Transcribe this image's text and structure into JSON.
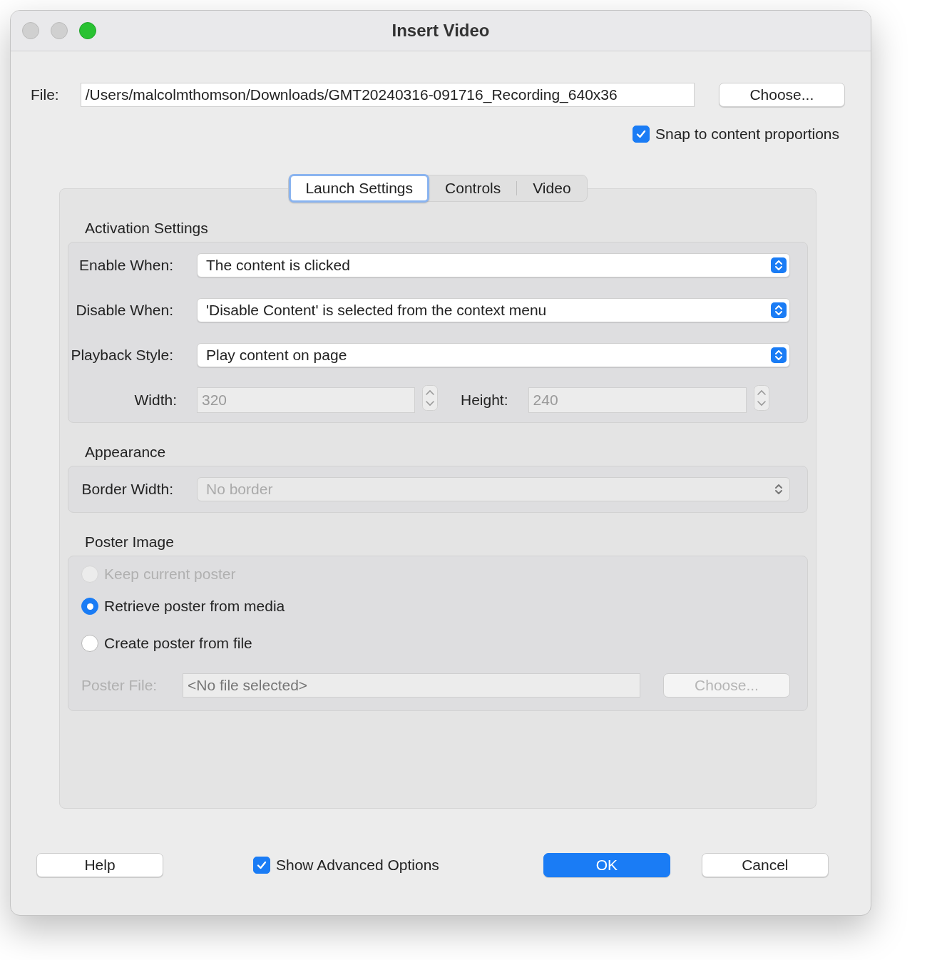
{
  "window": {
    "title": "Insert Video"
  },
  "file": {
    "label": "File:",
    "value": "/Users/malcolmthomson/Downloads/GMT20240316-091716_Recording_640x36",
    "button": "Choose..."
  },
  "snap": {
    "label": "Snap to content proportions",
    "checked": true
  },
  "tabs": [
    {
      "label": "Launch Settings",
      "selected": true
    },
    {
      "label": "Controls",
      "selected": false
    },
    {
      "label": "Video",
      "selected": false
    }
  ],
  "activation": {
    "title": "Activation Settings",
    "rows": [
      {
        "label": "Enable When:",
        "value": "The content is clicked"
      },
      {
        "label": "Disable When:",
        "value": "'Disable Content' is selected from the context menu"
      },
      {
        "label": "Playback Style:",
        "value": "Play content on page"
      }
    ],
    "width": {
      "label": "Width:",
      "value": "320",
      "disabled": true
    },
    "height": {
      "label": "Height:",
      "value": "240",
      "disabled": true
    }
  },
  "appearance": {
    "title": "Appearance",
    "border": {
      "label": "Border Width:",
      "value": "No border",
      "disabled": true
    }
  },
  "poster": {
    "title": "Poster Image",
    "options": [
      {
        "label": "Keep current poster",
        "selected": false,
        "disabled": true
      },
      {
        "label": "Retrieve poster from media",
        "selected": true,
        "disabled": false
      },
      {
        "label": "Create poster from file",
        "selected": false,
        "disabled": false
      }
    ],
    "file": {
      "label": "Poster File:",
      "placeholder": "<No file selected>",
      "button": "Choose...",
      "disabled": true
    }
  },
  "footer": {
    "help": "Help",
    "advanced": {
      "label": "Show Advanced Options",
      "checked": true
    },
    "ok": "OK",
    "cancel": "Cancel"
  }
}
